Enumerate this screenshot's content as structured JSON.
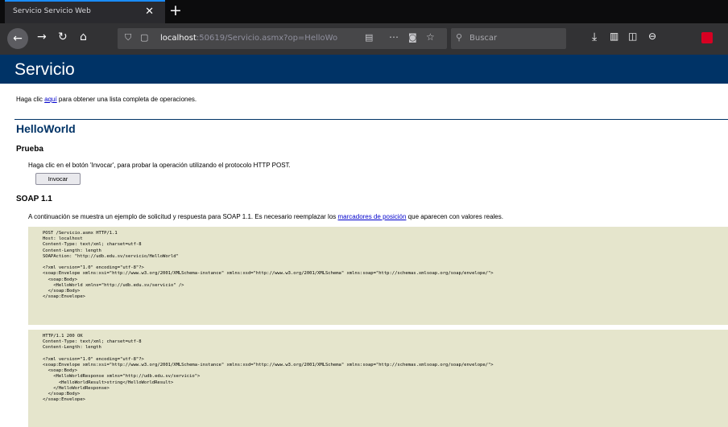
{
  "tab": {
    "title": "Servicio Servicio Web"
  },
  "address": {
    "host": "localhost",
    "path": ":50619/Servicio.asmx?op=HelloWo"
  },
  "search": {
    "placeholder": "Buscar"
  },
  "page": {
    "title": "Servicio",
    "intro_before": "Haga clic ",
    "intro_link": "aquí",
    "intro_after": " para obtener una lista completa de operaciones.",
    "operation": "HelloWorld",
    "test_heading": "Prueba",
    "test_text": "Haga clic en el botón 'Invocar', para probar la operación utilizando el protocolo HTTP POST.",
    "invoke_label": "Invocar",
    "soap_heading": "SOAP 1.1",
    "soap_before": "A continuación se muestra un ejemplo de solicitud y respuesta para SOAP 1.1. Es necesario reemplazar los ",
    "soap_link": "marcadores de posición",
    "soap_after": " que aparecen con valores reales.",
    "request": "POST /Servicio.asmx HTTP/1.1\nHost: localhost\nContent-Type: text/xml; charset=utf-8\nContent-Length: length\nSOAPAction: \"http://udb.edu.sv/servicio/HelloWorld\"\n\n<?xml version=\"1.0\" encoding=\"utf-8\"?>\n<soap:Envelope xmlns:xsi=\"http://www.w3.org/2001/XMLSchema-instance\" xmlns:xsd=\"http://www.w3.org/2001/XMLSchema\" xmlns:soap=\"http://schemas.xmlsoap.org/soap/envelope/\">\n  <soap:Body>\n    <HelloWorld xmlns=\"http://udb.edu.sv/servicio\" />\n  </soap:Body>\n</soap:Envelope>",
    "response": "HTTP/1.1 200 OK\nContent-Type: text/xml; charset=utf-8\nContent-Length: length\n\n<?xml version=\"1.0\" encoding=\"utf-8\"?>\n<soap:Envelope xmlns:xsi=\"http://www.w3.org/2001/XMLSchema-instance\" xmlns:xsd=\"http://www.w3.org/2001/XMLSchema\" xmlns:soap=\"http://schemas.xmlsoap.org/soap/envelope/\">\n  <soap:Body>\n    <HelloWorldResponse xmlns=\"http://udb.edu.sv/servicio\">\n      <HelloWorldResult>string</HelloWorldResult>\n    </HelloWorldResponse>\n  </soap:Body>\n</soap:Envelope>"
  },
  "icons": [
    "back-icon",
    "forward-icon",
    "reload-icon",
    "home-icon",
    "shield-icon",
    "page-icon",
    "reader-icon",
    "more-icon",
    "pocket-icon",
    "star-icon",
    "search-icon",
    "download-icon",
    "library-icon",
    "sidebar-icon",
    "extension-icon"
  ],
  "colors": {
    "header": "#003366",
    "code_bg": "#e5e5cc",
    "link": "#0000cc"
  }
}
